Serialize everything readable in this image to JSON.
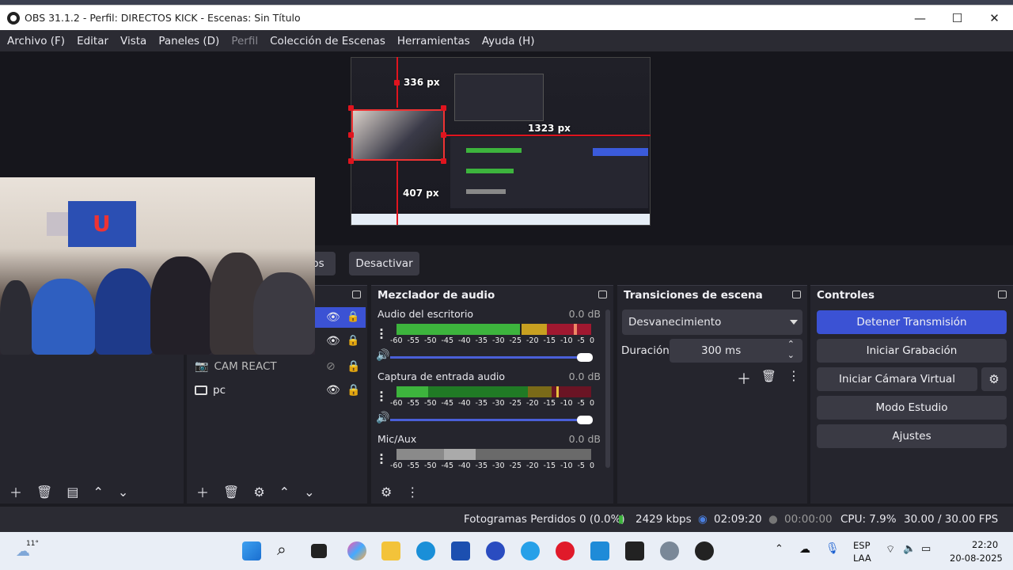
{
  "window": {
    "title": "OBS 31.1.2 - Perfil: DIRECTOS KICK - Escenas: Sin Título",
    "min": "—",
    "max": "☐",
    "close": "✕"
  },
  "menu": [
    "Archivo (F)",
    "Editar",
    "Vista",
    "Paneles (D)",
    "Perfil",
    "Colección de Escenas",
    "Herramientas",
    "Ayuda (H)"
  ],
  "preview": {
    "top_px": "336 px",
    "right_px": "1323 px",
    "bottom_px": "407 px"
  },
  "source_buttons": {
    "partial": "os",
    "deactivate": "Desactivar"
  },
  "sources": {
    "items": [
      {
        "name": "CAM REACT",
        "visible": false
      },
      {
        "name": "pc",
        "visible": true
      }
    ],
    "partial_u": "u"
  },
  "mixer": {
    "title": "Mezclador de audio",
    "channels": [
      {
        "name": "Audio del escritorio",
        "db": "0.0 dB"
      },
      {
        "name": "Captura de entrada audio",
        "db": "0.0 dB"
      },
      {
        "name": "Mic/Aux",
        "db": "0.0 dB"
      }
    ],
    "ticks": [
      "-60",
      "-55",
      "-50",
      "-45",
      "-40",
      "-35",
      "-30",
      "-25",
      "-20",
      "-15",
      "-10",
      "-5",
      "0"
    ]
  },
  "transitions": {
    "title": "Transiciones de escena",
    "selected": "Desvanecimiento",
    "duration_label": "Duración",
    "duration_value": "300 ms"
  },
  "controls": {
    "title": "Controles",
    "stop_stream": "Detener Transmisión",
    "start_recording": "Iniciar Grabación",
    "start_virtual_cam": "Iniciar Cámara Virtual",
    "studio_mode": "Modo Estudio",
    "settings": "Ajustes"
  },
  "status": {
    "dropped_frames": "Fotogramas Perdidos 0 (0.0%)",
    "bitrate": "2429 kbps",
    "stream_time": "02:09:20",
    "rec_time": "00:00:00",
    "cpu": "CPU: 7.9%",
    "fps": "30.00 / 30.00 FPS"
  },
  "taskbar": {
    "weather": "11°",
    "lang_top": "ESP",
    "lang_bottom": "LAA",
    "time": "22:20",
    "date": "20-08-2025"
  },
  "colors": {
    "accent": "#3b52d4",
    "meter_green": "#3db43d",
    "meter_yellow": "#c8a020",
    "meter_red": "#a01830",
    "guide_red": "#e0141e"
  }
}
